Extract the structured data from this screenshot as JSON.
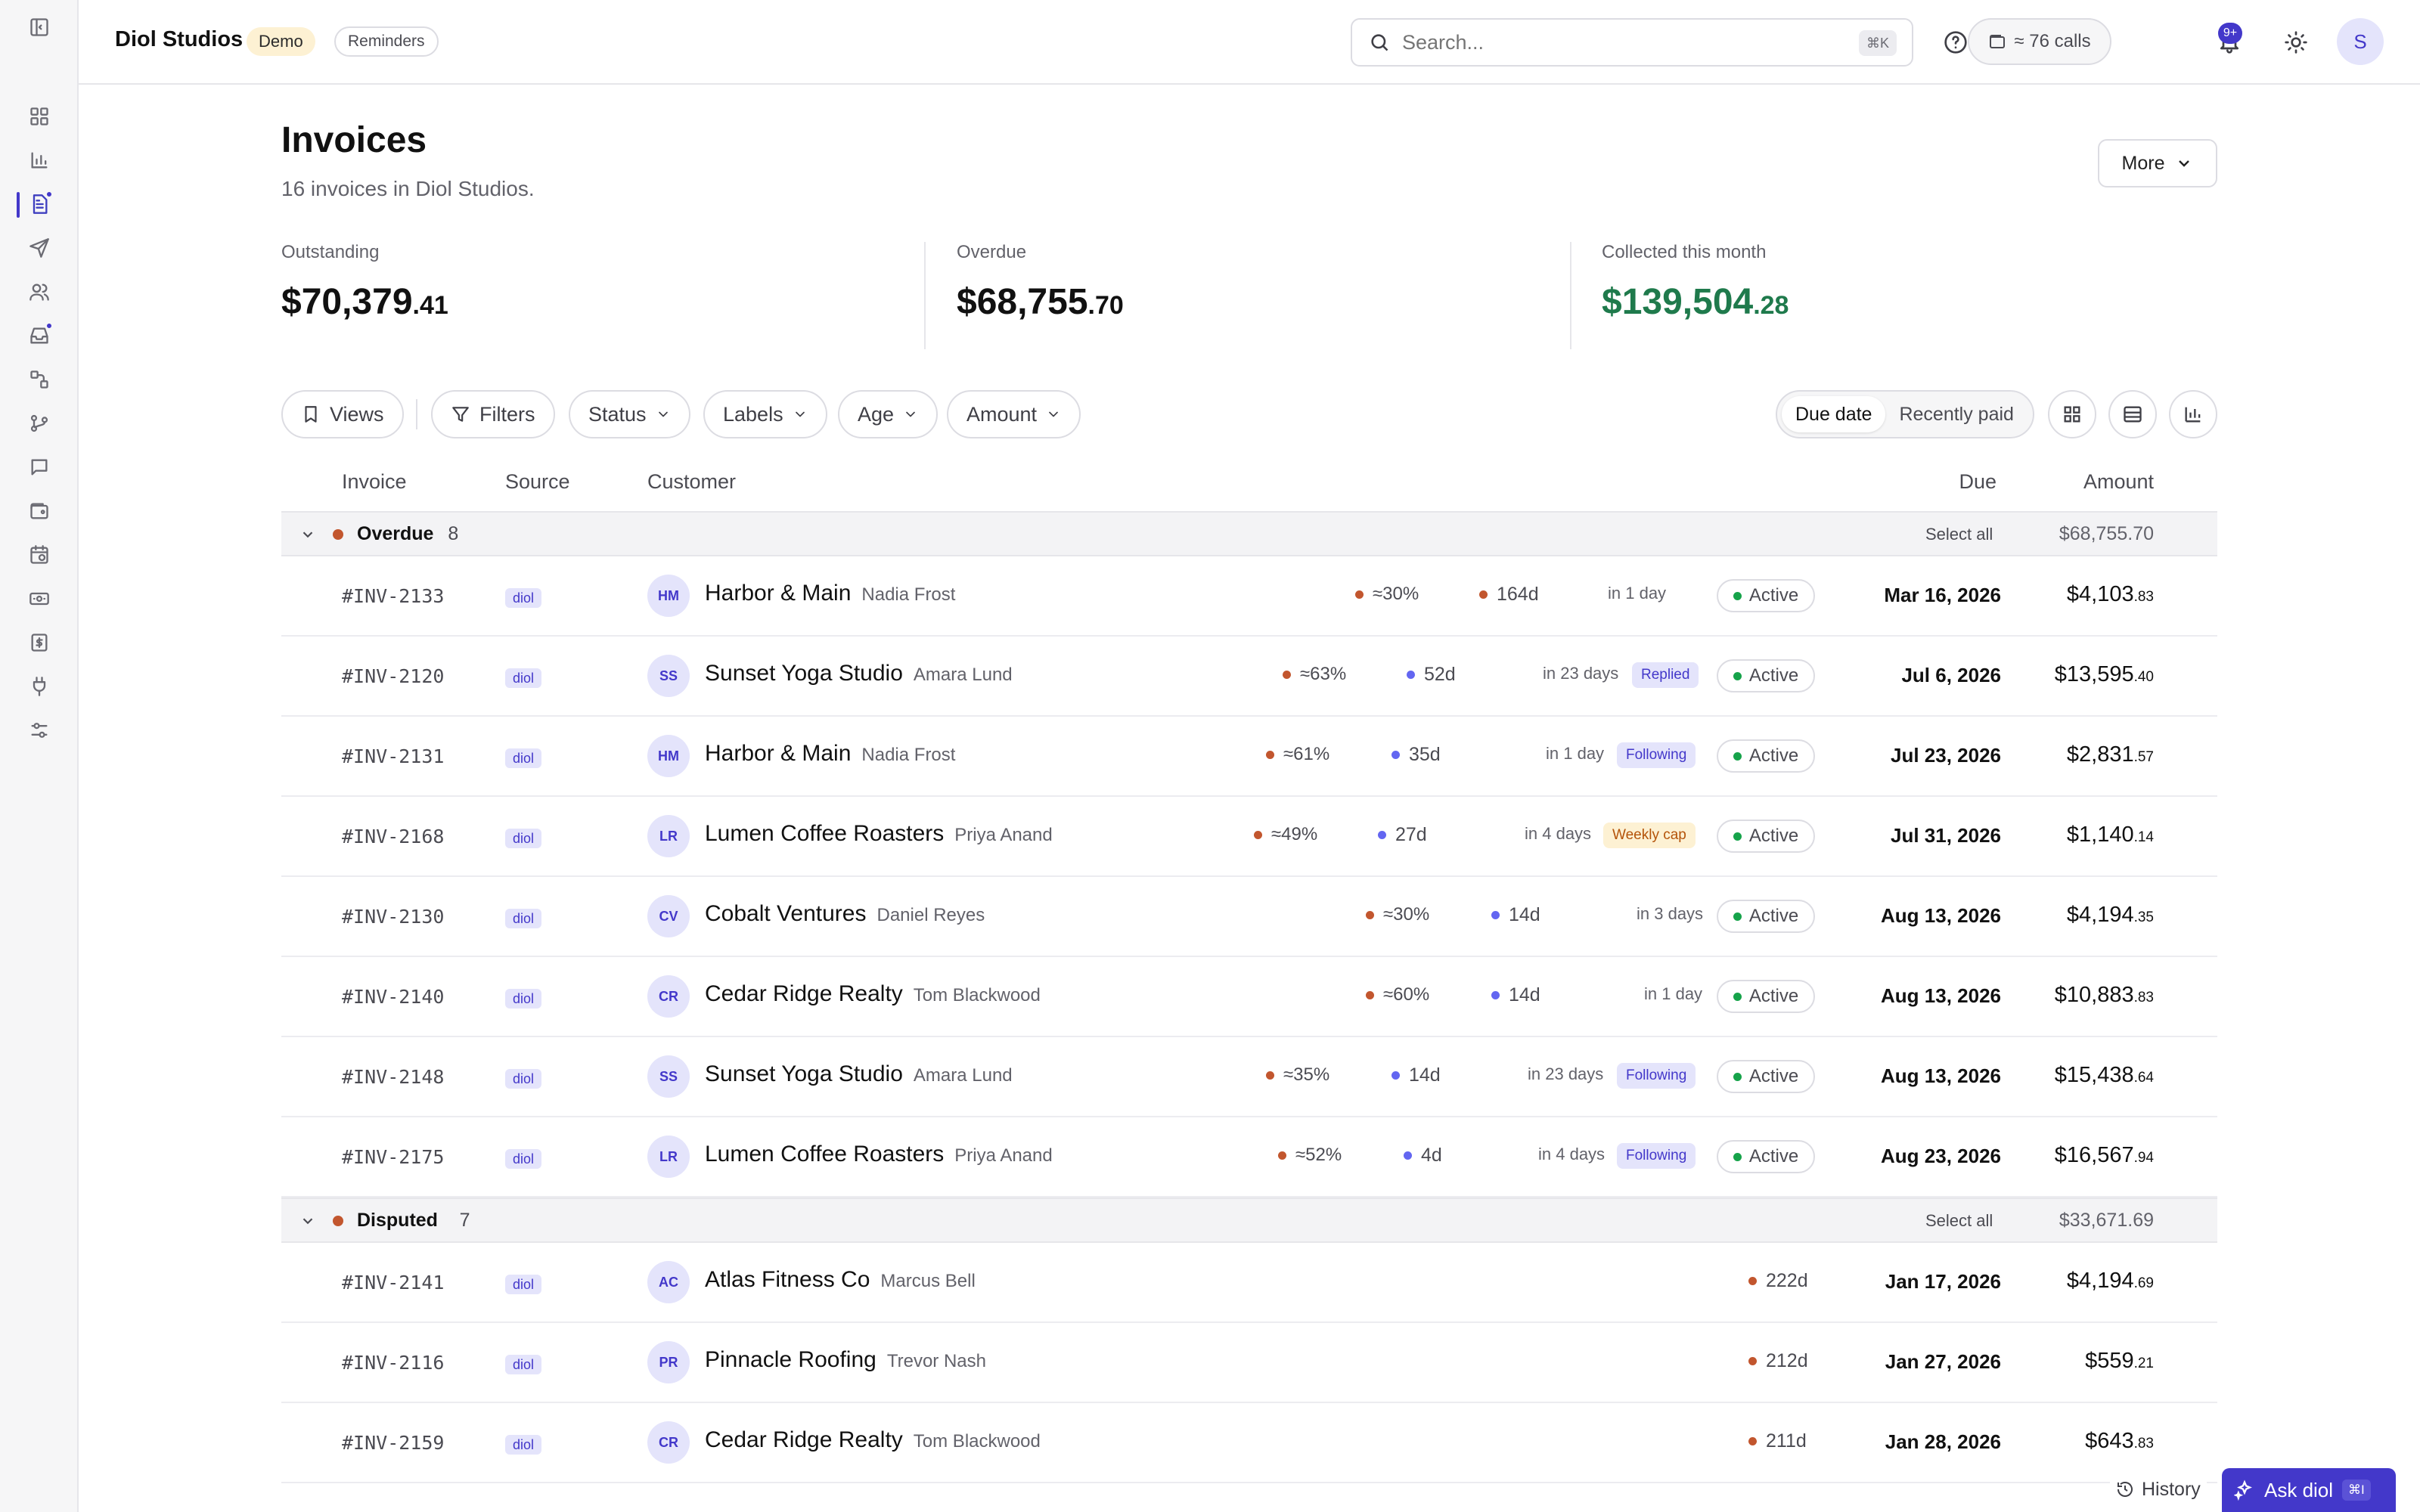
{
  "topbar": {
    "brand": "Diol Studios",
    "env_badge": "Demo",
    "reminders_label": "Reminders",
    "search_placeholder": "Search...",
    "search_shortcut": "⌘K",
    "calls_label": "≈ 76 calls",
    "notifications_count": "9+",
    "user_initial": "S"
  },
  "header": {
    "title": "Invoices",
    "subtitle": "16 invoices in Diol Studios.",
    "more_label": "More"
  },
  "stats": [
    {
      "label": "Outstanding",
      "dollars": "$70,379",
      "cents": ".41",
      "color": "#111111"
    },
    {
      "label": "Overdue",
      "dollars": "$68,755",
      "cents": ".70",
      "color": "#111111"
    },
    {
      "label": "Collected this month",
      "dollars": "$139,504",
      "cents": ".28",
      "color": "#1f7a4c"
    }
  ],
  "toolbar": {
    "views_label": "Views",
    "filters_label": "Filters",
    "status_label": "Status",
    "labels_label": "Labels",
    "age_label": "Age",
    "amount_label": "Amount",
    "sort_due": "Due date",
    "sort_paid": "Recently paid"
  },
  "table": {
    "headers": {
      "invoice": "Invoice",
      "source": "Source",
      "customer": "Customer",
      "due": "Due",
      "amount": "Amount"
    },
    "select_all": "Select all",
    "groups": [
      {
        "name": "Overdue",
        "count": "8",
        "total": "$68,755.70",
        "rows": [
          {
            "id": "#INV-2133",
            "source": "diol",
            "initials": "HM",
            "customer": "Harbor & Main",
            "contact": "Nadia Frost",
            "prob": "≈30%",
            "age": "164d",
            "age_dot": "or",
            "next": "in 1 day",
            "tag": "",
            "tag_style": "",
            "status": "Active",
            "due": "Mar 16, 2026",
            "amount": "$4,103",
            "cents": ".83"
          },
          {
            "id": "#INV-2120",
            "source": "diol",
            "initials": "SS",
            "customer": "Sunset Yoga Studio",
            "contact": "Amara Lund",
            "prob": "≈63%",
            "age": "52d",
            "age_dot": "bl",
            "next": "in 23 days",
            "tag": "Replied",
            "tag_style": "blue",
            "status": "Active",
            "due": "Jul 6, 2026",
            "amount": "$13,595",
            "cents": ".40"
          },
          {
            "id": "#INV-2131",
            "source": "diol",
            "initials": "HM",
            "customer": "Harbor & Main",
            "contact": "Nadia Frost",
            "prob": "≈61%",
            "age": "35d",
            "age_dot": "bl",
            "next": "in 1 day",
            "tag": "Following",
            "tag_style": "blue",
            "status": "Active",
            "due": "Jul 23, 2026",
            "amount": "$2,831",
            "cents": ".57"
          },
          {
            "id": "#INV-2168",
            "source": "diol",
            "initials": "LR",
            "customer": "Lumen Coffee Roasters",
            "contact": "Priya Anand",
            "prob": "≈49%",
            "age": "27d",
            "age_dot": "bl",
            "next": "in 4 days",
            "tag": "Weekly cap",
            "tag_style": "amber",
            "status": "Active",
            "due": "Jul 31, 2026",
            "amount": "$1,140",
            "cents": ".14"
          },
          {
            "id": "#INV-2130",
            "source": "diol",
            "initials": "CV",
            "customer": "Cobalt Ventures",
            "contact": "Daniel Reyes",
            "prob": "≈30%",
            "age": "14d",
            "age_dot": "bl",
            "next": "in 3 days",
            "tag": "",
            "tag_style": "",
            "status": "Active",
            "due": "Aug 13, 2026",
            "amount": "$4,194",
            "cents": ".35"
          },
          {
            "id": "#INV-2140",
            "source": "diol",
            "initials": "CR",
            "customer": "Cedar Ridge Realty",
            "contact": "Tom Blackwood",
            "prob": "≈60%",
            "age": "14d",
            "age_dot": "bl",
            "next": "in 1 day",
            "tag": "",
            "tag_style": "",
            "status": "Active",
            "due": "Aug 13, 2026",
            "amount": "$10,883",
            "cents": ".83"
          },
          {
            "id": "#INV-2148",
            "source": "diol",
            "initials": "SS",
            "customer": "Sunset Yoga Studio",
            "contact": "Amara Lund",
            "prob": "≈35%",
            "age": "14d",
            "age_dot": "bl",
            "next": "in 23 days",
            "tag": "Following",
            "tag_style": "blue",
            "status": "Active",
            "due": "Aug 13, 2026",
            "amount": "$15,438",
            "cents": ".64"
          },
          {
            "id": "#INV-2175",
            "source": "diol",
            "initials": "LR",
            "customer": "Lumen Coffee Roasters",
            "contact": "Priya Anand",
            "prob": "≈52%",
            "age": "4d",
            "age_dot": "bl",
            "next": "in 4 days",
            "tag": "Following",
            "tag_style": "blue",
            "status": "Active",
            "due": "Aug 23, 2026",
            "amount": "$16,567",
            "cents": ".94"
          }
        ]
      },
      {
        "name": "Disputed",
        "count": "7",
        "total": "$33,671.69",
        "rows": [
          {
            "id": "#INV-2141",
            "source": "diol",
            "initials": "AC",
            "customer": "Atlas Fitness Co",
            "contact": "Marcus Bell",
            "prob": "",
            "age": "222d",
            "age_dot": "or",
            "next": "",
            "tag": "",
            "tag_style": "",
            "status": "",
            "due": "Jan 17, 2026",
            "amount": "$4,194",
            "cents": ".69"
          },
          {
            "id": "#INV-2116",
            "source": "diol",
            "initials": "PR",
            "customer": "Pinnacle Roofing",
            "contact": "Trevor Nash",
            "prob": "",
            "age": "212d",
            "age_dot": "or",
            "next": "",
            "tag": "",
            "tag_style": "",
            "status": "",
            "due": "Jan 27, 2026",
            "amount": "$559",
            "cents": ".21"
          },
          {
            "id": "#INV-2159",
            "source": "diol",
            "initials": "CR",
            "customer": "Cedar Ridge Realty",
            "contact": "Tom Blackwood",
            "prob": "",
            "age": "211d",
            "age_dot": "or",
            "next": "",
            "tag": "",
            "tag_style": "",
            "status": "",
            "due": "Jan 28, 2026",
            "amount": "$643",
            "cents": ".83"
          }
        ]
      }
    ]
  },
  "footer": {
    "history_label": "History",
    "ask_label": "Ask diol",
    "ask_shortcut": "⌘I"
  }
}
